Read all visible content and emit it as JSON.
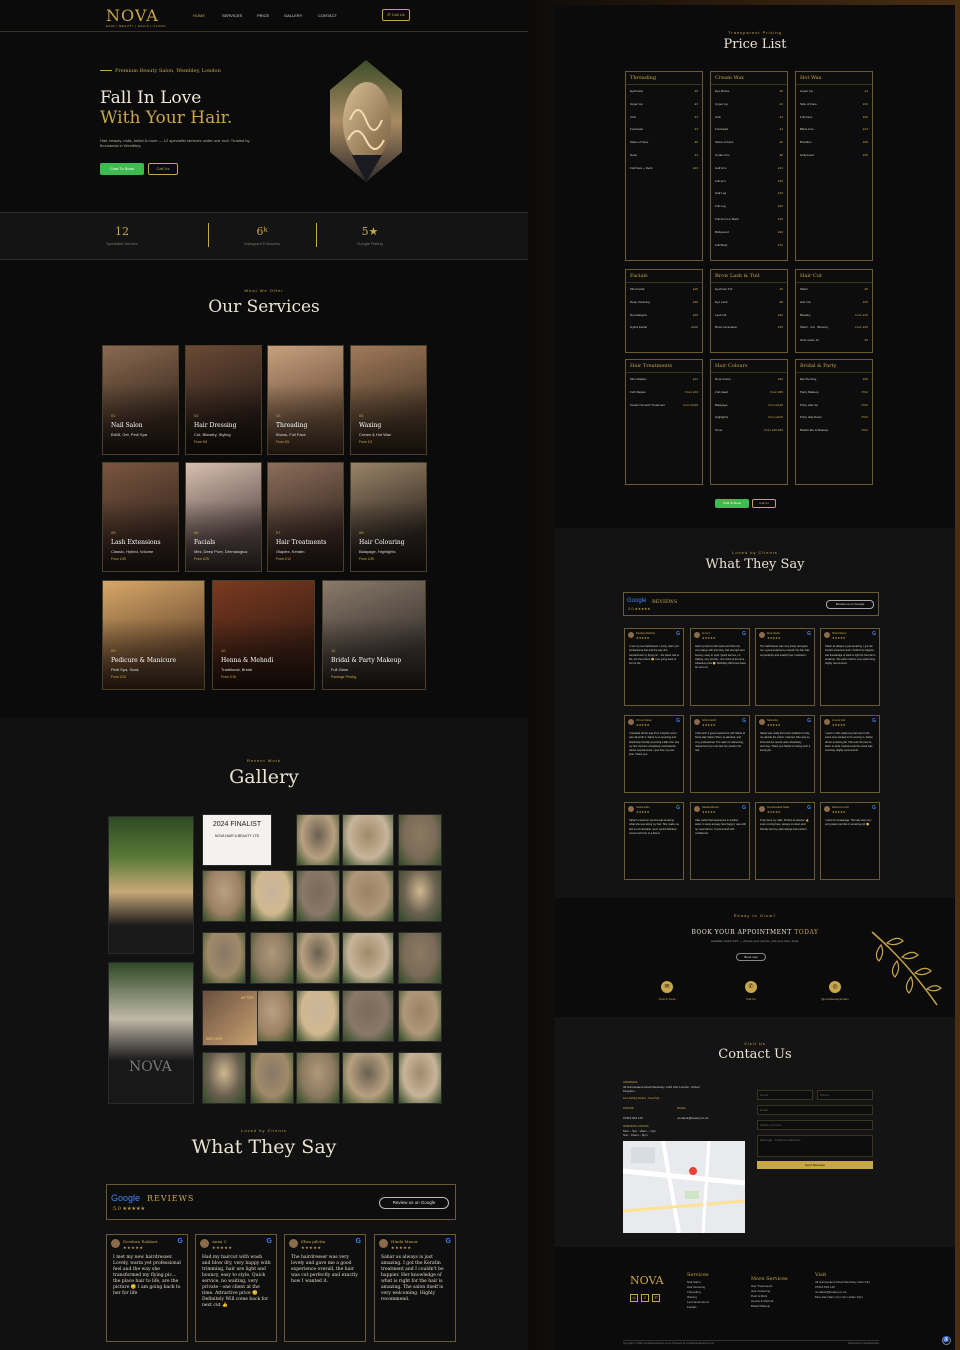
{
  "brand": {
    "name": "NOVA",
    "tagline": "HAIR | BEAUTY | NAILS | CLINIC"
  },
  "nav": {
    "items": [
      "HOME",
      "SERVICES",
      "PRICE",
      "GALLERY",
      "CONTACT"
    ],
    "call": "Call Us"
  },
  "hero": {
    "kicker": "Premium Beauty Salon, Wembley, London",
    "title_line1": "Fall In Love",
    "title_line2": "With Your Hair.",
    "desc": "Hair, beauty, nails, bridal & more — 12 specialist services under one roof. Trusted by thousands in Wembley.",
    "book": "Chat To Book",
    "call": "Call Us"
  },
  "stats": [
    {
      "n": "12",
      "l": "Specialist Service"
    },
    {
      "n": "6ᵏ",
      "l": "Instagram Followers"
    },
    {
      "n": "5★",
      "l": "Google Rating"
    }
  ],
  "services": {
    "kicker": "What We Offer",
    "title": "Our Services",
    "cards": [
      {
        "num": "01",
        "t": "Nail Salon",
        "d": "BIAB, Gel, Pedi Spa",
        "p": ""
      },
      {
        "num": "02",
        "t": "Hair Dressing",
        "d": "Cut, Blowdry, Styling",
        "p": "From £8"
      },
      {
        "num": "03",
        "t": "Threading",
        "d": "Brows, Full Face",
        "p": "From £5"
      },
      {
        "num": "04",
        "t": "Waxing",
        "d": "Cream & Hot Wax",
        "p": "From £3"
      },
      {
        "num": "05",
        "t": "Lash Extensions",
        "d": "Classic, Hybrid, Volume",
        "p": "From £35"
      },
      {
        "num": "06",
        "t": "Facials",
        "d": "Mini, Deep Pore, Dermalogica",
        "p": "From £25"
      },
      {
        "num": "07",
        "t": "Hair Treatments",
        "d": "Olaplex, Keratin",
        "p": "From £12"
      },
      {
        "num": "08",
        "t": "Hair Colouring",
        "d": "Balayage, Highlights",
        "p": "From £35"
      },
      {
        "num": "09",
        "t": "Pedicure & Manicure",
        "d": "Pedi Spa, Soak",
        "p": "From £20"
      },
      {
        "num": "10",
        "t": "Henna & Mehndi",
        "d": "Traditional, Bridal",
        "p": "From £15"
      },
      {
        "num": "12",
        "t": "Bridal & Party Makeup",
        "d": "Full Glam",
        "p": "Package Pricing"
      }
    ]
  },
  "gallery": {
    "kicker": "Recent Work",
    "title": "Gallery",
    "award": {
      "line1": "2024 FINALIST",
      "line2": "NOVA HAIR & BEAUTY LTD"
    },
    "before": "BEFORE",
    "after": "AFTER"
  },
  "reviews_left": {
    "kicker": "Loved by Clients",
    "title": "What They Say",
    "google": "Google",
    "reviews": "REVIEWS",
    "rating": "5.0 ★★★★★",
    "btn": "Review us on Google",
    "cards": [
      {
        "n": "Deedara Rakhari",
        "t": "I met my new hairdresser. Lovely, warm yet professional feel and the way she transformed my flying pic... the place hair to life, are the picture 😊 I am going back to her for life"
      },
      {
        "n": "Anna C",
        "t": "Had my haircut with wash and blow dry, very happy with trimming, hair are light and bouncy, easy to style. Quick service, no waiting, very private - one client at the time. Attractive price 😊 Definitely Will come back for next cut 👍"
      },
      {
        "n": "Elisa pilotta",
        "t": "The hairdresser was very lovely and gave me a good experience overall, the hair was cut perfectly and exactly how I wanted it."
      },
      {
        "n": "Hinda Manor",
        "t": "Sahar as always is just amazing. I got the Keratin treatment and I couldn't be happier. Her knowledge of what is right for the hair is amazing. The salon itself is very welcoming. Highly recommend."
      }
    ]
  },
  "price": {
    "kicker": "Transparent Pricing",
    "title": "Price List",
    "btn_book": "Chat To Book",
    "btn_call": "Call Us",
    "boxes": [
      {
        "h": "Threading",
        "rows": [
          [
            "Eyebrows",
            "£5"
          ],
          [
            "Upper Lip",
            "£3"
          ],
          [
            "Chin",
            "£3"
          ],
          [
            "Forehead",
            "£3"
          ],
          [
            "Sides of Face",
            "£5"
          ],
          [
            "Neck",
            "£4"
          ],
          [
            "Full Face + Neck",
            "£20"
          ]
        ]
      },
      {
        "h": "Cream Wax",
        "rows": [
          [
            "Eye Brows",
            "£6"
          ],
          [
            "Upper Lip",
            "£4"
          ],
          [
            "Chin",
            "£4"
          ],
          [
            "Forehead",
            "£4"
          ],
          [
            "Sides of Face",
            "£6"
          ],
          [
            "Under Arm",
            "£8"
          ],
          [
            "Half Arm",
            "£13"
          ],
          [
            "Full arm",
            "£15"
          ],
          [
            "Half Leg",
            "£15"
          ],
          [
            "Full Leg",
            "£20"
          ],
          [
            "Full Front or Back",
            "£15"
          ],
          [
            "Bollywood",
            "£30"
          ],
          [
            "Full Body",
            "£70"
          ]
        ]
      },
      {
        "h": "Hot Wax",
        "rows": [
          [
            "Upper Lip",
            "£4"
          ],
          [
            "Side of Face",
            "£13"
          ],
          [
            "Full Face",
            "£20"
          ],
          [
            "Bikini Line",
            "£13"
          ],
          [
            "Brazilian",
            "£25"
          ],
          [
            "Hollywood",
            "£35"
          ]
        ]
      },
      {
        "h": "Facials",
        "rows": [
          [
            "Mini Facial",
            "£25"
          ],
          [
            "Deep Cleaning",
            "£35"
          ],
          [
            "Dermalogica",
            "£45"
          ],
          [
            "Hydra Facial",
            "£100"
          ]
        ]
      },
      {
        "h": "Brow Lash & Tint",
        "rows": [
          [
            "Eyebrow Tint",
            "£5"
          ],
          [
            "Eye Lash",
            "£8"
          ],
          [
            "Lash Lift",
            "£40"
          ],
          [
            "Brow Lamination",
            "£35"
          ]
        ]
      },
      {
        "h": "Hair Cut",
        "rows": [
          [
            "Wash",
            "£5"
          ],
          [
            "Hair Cut",
            "£15"
          ],
          [
            "Blowdry",
            "From £15"
          ],
          [
            "Wash · Cut · Blowdry",
            "From £25"
          ],
          [
            "Girls under 12",
            "£5"
          ]
        ]
      },
      {
        "h": "Hair Treatments",
        "rows": [
          [
            "Mini Olaplex",
            "£12"
          ],
          [
            "Full Olaplex",
            "From £30"
          ],
          [
            "Keratin Smooth Treatment",
            "From £120"
          ]
        ]
      },
      {
        "h": "Hair Colours",
        "rows": [
          [
            "Root Colour",
            "£30"
          ],
          [
            "Full Head",
            "From £50"
          ],
          [
            "Balayage",
            "From £120"
          ],
          [
            "Highlights",
            "From £100"
          ],
          [
            "Toner",
            "From £40-£50"
          ]
        ]
      },
      {
        "h": "Bridal & Party",
        "rows": [
          [
            "Ear Piercing",
            "£30"
          ],
          [
            "Party Makeup",
            "POA"
          ],
          [
            "Party Hair Up",
            "POA"
          ],
          [
            "Party Hair Down",
            "POA"
          ],
          [
            "Bridal Hair & Makeup",
            "POA"
          ]
        ]
      }
    ]
  },
  "reviews_right": {
    "kicker": "Loved by Clients",
    "title": "What They Say",
    "google": "Google",
    "reviews": "REVIEWS",
    "rating": "5.0 ★★★★★",
    "btn": "Review us on Google",
    "cards": [
      {
        "n": "Deedara Rakhari",
        "t": "I met my new hairdresser. Lovely, warm yet professional feel and the way she transformed my flying pic... the place hair to life, are the picture 😊 I am going back to her for life"
      },
      {
        "n": "Anna C",
        "t": "Had my haircut with wash and blow dry, very happy with trimming, hair are light and bouncy, easy to style. Quick service, no waiting, very private - one client at the time. Attractive price 😊 Definitely Will come back for next cut"
      },
      {
        "n": "Elisa pilotta",
        "t": "The hairdresser was very lovely and gave me a good experience overall, the hair was cut perfectly and exactly how I wanted it."
      },
      {
        "n": "Hinda Manor",
        "t": "Sahar as always is just amazing. I got the Keratin treatment and I couldn't be happier. Her knowledge of what is right for the hair is amazing. The salon itself is very welcoming. Highly recommend."
      },
      {
        "n": "Ozmus Sultan",
        "t": "I travelled all the way from Croydon and it was all worth it. Sahar is so amazing and absolutely friendly at putting a little chin sea my first visit she completely understands clients requirements. I just love my new look. Thank you"
      },
      {
        "n": "Sofia Ivanish",
        "t": "I had such a great experience with Sahar at Nova Hair Salon! She's so talented, and very professional. The salon is welcoming, relaxed and you can feel her passion for hair."
      },
      {
        "n": "Naila Ada",
        "t": "Sahar was really kind and confident to help me decide the colour I wanted. She was so kind and the results were absolutely stunning. Thank you Sahar for doing such a lovely job."
      },
      {
        "n": "Lina de Aldi",
        "t": "I went in with really long hair and in the same time wanted to be coming in. Sahar did an amazing job. She took the time to listen to what I wanted and the result was stunning. Highly recommend."
      },
      {
        "n": "Jowita Gollo",
        "t": "Sahar's customer service was amazing while she was doing my hair. She made me feel so comfortable, and I would definitely recommend her to a friend."
      },
      {
        "n": "Natalia Alberka",
        "t": "After sahar had experience in another salon, it came anyway how happy I was with my new haircut. I recommend with confidence!"
      },
      {
        "n": "Amohandawa Salas",
        "t": "Truly done my nails. Perfect as always! 👍 Love coming here, always so clean and friendly and my nails always look perfect."
      },
      {
        "n": "Rebecca Grant",
        "t": "I went for a balayage. The lady was very very patient and lat on amazing job 😊"
      }
    ]
  },
  "cta": {
    "kicker": "Ready to Glow?",
    "title_a": "BOOK YOUR APPOINTMENT ",
    "title_b": "TODAY",
    "sub": "Available online 24/7 — choose your service, pick your time, done.",
    "btn": "Book now",
    "icons": [
      "Chat to book",
      "Call Us",
      "@novabeautylondon"
    ]
  },
  "contact": {
    "kicker": "Visit Us",
    "title": "Contact Us",
    "address_h": "ADDRESS",
    "address": "34 Harrowdene Road Wembley, HA0 4JH London, United Kingdom",
    "address_note": "Free Parking Nearby · Near Park",
    "phone_h": "PHONE",
    "phone": "07916 801 115",
    "email_h": "EMAIL",
    "email": "novahair@beauty.co.uk",
    "hours_h": "OPENING HOURS",
    "hours1": "Mon – Sat · 10am – 7pm",
    "hours2": "Sun · 10am – 5pm",
    "form": {
      "name": "Name",
      "phone": "Phone",
      "email": "Email",
      "service": "Select a service",
      "message": "Message · Preferred date/time",
      "send": "Send Message"
    }
  },
  "footer": {
    "brand": "NOVA",
    "services_h": "Services",
    "services": [
      "Nail Salon",
      "Hair Dressing",
      "Threading",
      "Waxing",
      "Lash Extensions",
      "Facials"
    ],
    "more_h": "More Services",
    "more": [
      "Hair Treatments",
      "Hair Colouring",
      "Pedi & Mani",
      "Henna & Mehndi",
      "Bridal Makeup"
    ],
    "visit_h": "Visit",
    "visit": [
      "34 Harrowdene Road Wembley HA0 4JH",
      "07916 801 115",
      "novahair@beauty.co.uk",
      "Mon-Sat 10am-7pm Sun 10am-5pm"
    ],
    "copy": "Copyright © 2026 novahairandbeauty.co.uk. Powered by novahairandbeauty.co.uk",
    "credit": "Designed by NovaWebLabs"
  }
}
